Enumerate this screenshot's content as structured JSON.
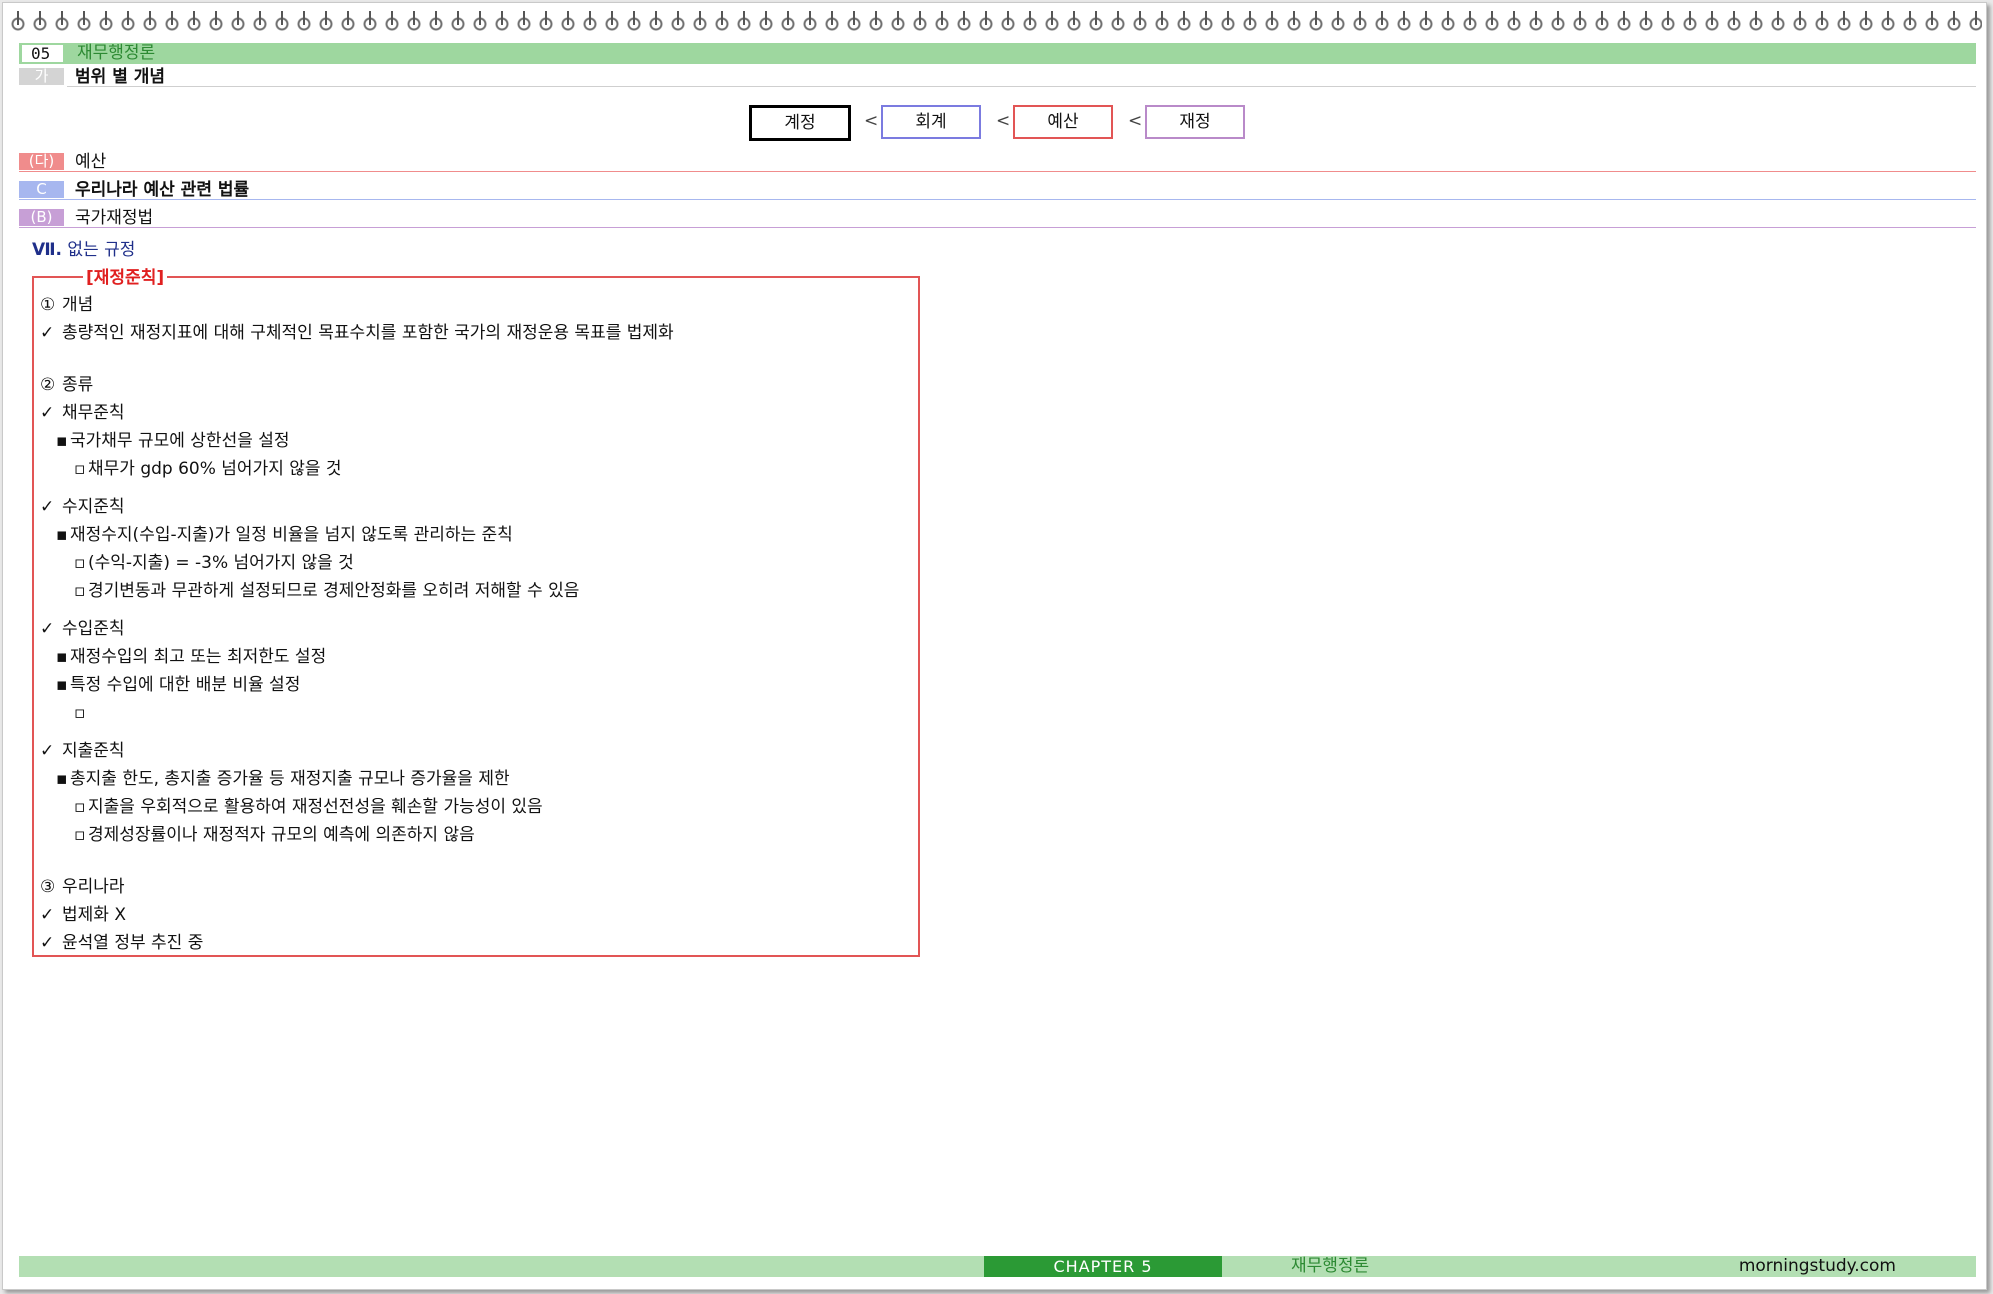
{
  "chapter": {
    "number": "05",
    "title": "재무행정론"
  },
  "section_ga": {
    "tag": "가",
    "title": "범위 별 개념"
  },
  "concepts": {
    "items": [
      "계정",
      "회계",
      "예산",
      "재정"
    ],
    "separator": "<",
    "colors": [
      "#000000",
      "#7b7be0",
      "#e25555",
      "#b98ac9"
    ]
  },
  "section_da": {
    "tag": "(다)",
    "title": "예산",
    "color": "#f08c8c"
  },
  "section_c": {
    "tag": "C",
    "title": "우리나라 예산 관련 법률",
    "color": "#a7b7ef"
  },
  "section_b": {
    "tag": "(B)",
    "title": "국가재정법",
    "color": "#c79fd6"
  },
  "subhead": {
    "numeral": "Ⅶ.",
    "title": "없는 규정"
  },
  "box": {
    "legend": "[재정준칙]",
    "lines": [
      {
        "marker": "①",
        "text": "개념"
      },
      {
        "marker": "✓",
        "text": "총량적인 재정지표에 대해 구체적인 목표수치를 포함한 국가의 재정운용 목표를 법제화"
      },
      {
        "marker": "②",
        "text": "종류"
      },
      {
        "marker": "✓",
        "text": "채무준칙"
      },
      {
        "marker": "▪",
        "text": "국가채무 규모에 상한선을 설정"
      },
      {
        "marker": "▫",
        "text": "채무가 gdp 60% 넘어가지 않을 것"
      },
      {
        "marker": "✓",
        "text": "수지준칙"
      },
      {
        "marker": "▪",
        "text": "재정수지(수입-지출)가 일정 비율을 넘지 않도록 관리하는 준칙"
      },
      {
        "marker": "▫",
        "text": "(수익-지출) = -3% 넘어가지 않을 것"
      },
      {
        "marker": "▫",
        "text": "경기변동과 무관하게 설정되므로 경제안정화를 오히려 저해할 수 있음"
      },
      {
        "marker": "✓",
        "text": "수입준칙"
      },
      {
        "marker": "▪",
        "text": "재정수입의 최고 또는 최저한도 설정"
      },
      {
        "marker": "▪",
        "text": "특정 수입에 대한 배분 비율 설정"
      },
      {
        "marker": "▫",
        "text": ""
      },
      {
        "marker": "✓",
        "text": "지출준칙"
      },
      {
        "marker": "▪",
        "text": "총지출 한도, 총지출 증가율 등 재정지출 규모나 증가율을 제한"
      },
      {
        "marker": "▫",
        "text": "지출을 우회적으로 활용하여 재정선전성을 훼손할 가능성이 있음"
      },
      {
        "marker": "▫",
        "text": "경제성장률이나 재정적자 규모의 예측에 의존하지 않음"
      },
      {
        "marker": "③",
        "text": "우리나라"
      },
      {
        "marker": "✓",
        "text": "법제화 X"
      },
      {
        "marker": "✓",
        "text": "윤석열 정부 추진 중"
      }
    ]
  },
  "footer": {
    "chapter": "CHAPTER 5",
    "title": "재무행정론",
    "site": "morningstudy.com"
  }
}
